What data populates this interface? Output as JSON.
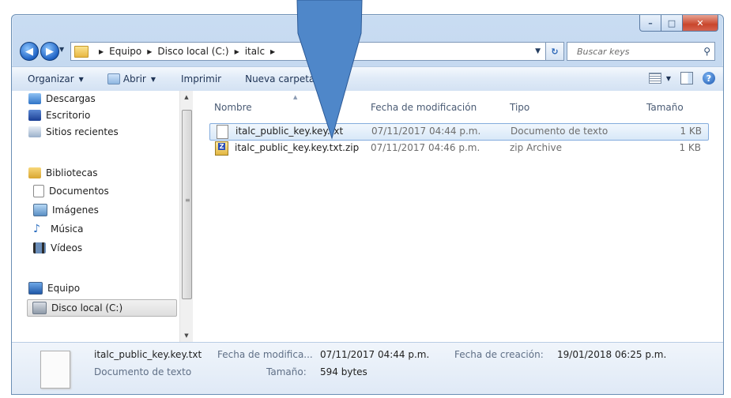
{
  "window": {
    "min_glyph": "–",
    "max_glyph": "□",
    "close_glyph": "✕"
  },
  "address": {
    "crumbs": [
      "Equipo",
      "Disco local (C:)",
      "italc"
    ],
    "search_placeholder": "Buscar keys"
  },
  "toolbar": {
    "organize": "Organizar",
    "open": "Abrir",
    "print": "Imprimir",
    "new_folder": "Nueva carpeta"
  },
  "nav": {
    "items": [
      {
        "label": "Descargas",
        "icon": "downloads-icon"
      },
      {
        "label": "Escritorio",
        "icon": "desktop-icon"
      },
      {
        "label": "Sitios recientes",
        "icon": "recent-places-icon"
      },
      {
        "label": "Bibliotecas",
        "icon": "libraries-icon"
      },
      {
        "label": "Documentos",
        "icon": "documents-icon"
      },
      {
        "label": "Imágenes",
        "icon": "pictures-icon"
      },
      {
        "label": "Música",
        "icon": "music-icon"
      },
      {
        "label": "Vídeos",
        "icon": "videos-icon"
      },
      {
        "label": "Equipo",
        "icon": "computer-icon"
      },
      {
        "label": "Disco local (C:)",
        "icon": "local-disk-icon"
      }
    ]
  },
  "files": {
    "columns": {
      "name": "Nombre",
      "date": "Fecha de modificación",
      "type": "Tipo",
      "size": "Tamaño"
    },
    "rows": [
      {
        "name": "italc_public_key.key.txt",
        "date": "07/11/2017 04:44 p.m.",
        "type": "Documento de texto",
        "size": "1 KB",
        "icon": "text-file-icon",
        "selected": true
      },
      {
        "name": "italc_public_key.key.txt.zip",
        "date": "07/11/2017 04:46 p.m.",
        "type": "zip Archive",
        "size": "1 KB",
        "icon": "zip-file-icon",
        "selected": false
      }
    ]
  },
  "details": {
    "name": "italc_public_key.key.txt",
    "type": "Documento de texto",
    "modified_label": "Fecha de modifica...",
    "modified_value": "07/11/2017 04:44 p.m.",
    "created_label": "Fecha de creación:",
    "created_value": "19/01/2018 06:25 p.m.",
    "size_label": "Tamaño:",
    "size_value": "594 bytes"
  },
  "colors": {
    "pointer_fill": "#4f87c9",
    "pointer_stroke": "#2d5a96"
  }
}
